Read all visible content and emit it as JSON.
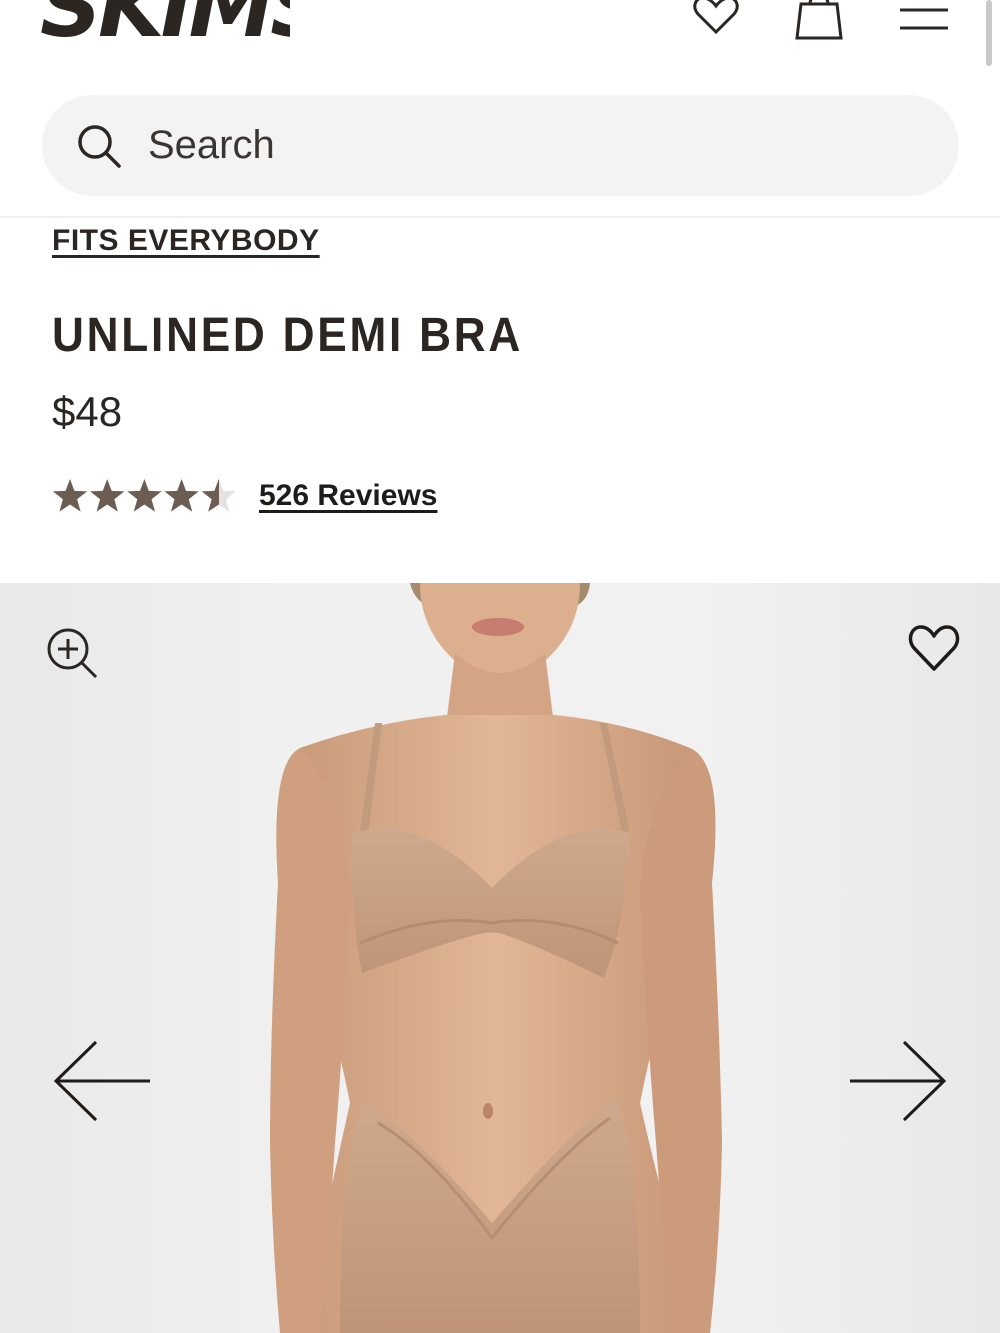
{
  "header": {
    "logo_text": "SKIMS",
    "icons": [
      "heart-icon",
      "shopping-bag-icon",
      "menu-icon"
    ]
  },
  "search": {
    "placeholder": "Search",
    "value": ""
  },
  "product": {
    "collection": "FITS EVERYBODY",
    "title": "UNLINED DEMI BRA",
    "price": "$48",
    "rating": 4.5,
    "rating_max": 5,
    "reviews_label": "526 Reviews"
  },
  "gallery": {
    "icons": [
      "zoom-in-icon",
      "favorite-heart-icon",
      "arrow-left-icon",
      "arrow-right-icon"
    ]
  },
  "colors": {
    "text": "#2b2622",
    "star": "#6b5d52",
    "search_bg": "#f3f3f3",
    "gallery_bg": "#f0f0f0",
    "skin": "#dcae8d",
    "garment": "#c9a185"
  }
}
